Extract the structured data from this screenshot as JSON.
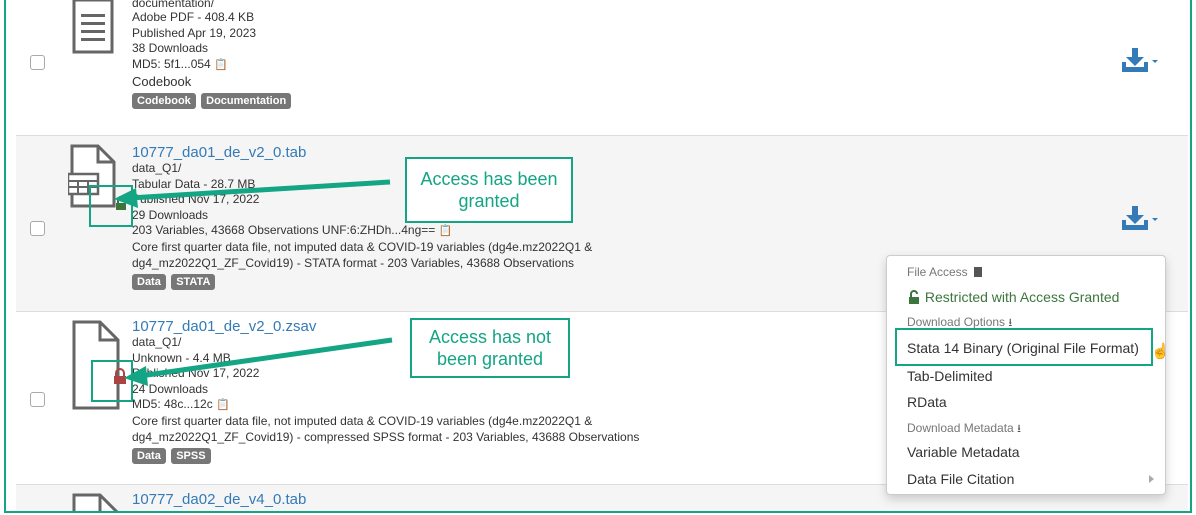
{
  "files": [
    {
      "folder_partial": "documentation/",
      "type_size": "Adobe PDF - 408.4 KB",
      "published": "Published Apr 19, 2023",
      "downloads": "38 Downloads",
      "checksum": "MD5: 5f1...054",
      "description": "Codebook",
      "tags": [
        "Codebook",
        "Documentation"
      ]
    },
    {
      "name": "10777_da01_de_v2_0.tab",
      "folder": "data_Q1/",
      "type_size": "Tabular Data - 28.7 MB",
      "published": "Published Nov 17, 2022",
      "downloads": "29 Downloads",
      "checksum": "203 Variables, 43668 Observations UNF:6:ZHDh...4ng==",
      "description_1": "Core first quarter data file, not imputed data & COVID-19 variables (dg4e.mz2022Q1 &",
      "description_2": "dg4_mz2022Q1_ZF_Covid19) - STATA format - 203 Variables, 43688 Observations",
      "tags": [
        "Data",
        "STATA"
      ]
    },
    {
      "name": "10777_da01_de_v2_0.zsav",
      "folder": "data_Q1/",
      "type_size": "Unknown - 4.4 MB",
      "published": "Published Nov 17, 2022",
      "downloads": "24 Downloads",
      "checksum": "MD5: 48c...12c",
      "description_1": "Core first quarter data file, not imputed data & COVID-19 variables (dg4e.mz2022Q1 &",
      "description_2": "dg4_mz2022Q1_ZF_Covid19) - compressed SPSS format - 203 Variables, 43688 Observations",
      "tags": [
        "Data",
        "SPSS"
      ]
    },
    {
      "name": "10777_da02_de_v4_0.tab"
    }
  ],
  "annotations": {
    "granted_line1": "Access has been",
    "granted_line2": "granted",
    "not_granted_line1": "Access has not",
    "not_granted_line2": "been granted"
  },
  "menu": {
    "file_access_header": "File Access",
    "restricted_label": "Restricted with Access Granted",
    "download_options_header": "Download Options",
    "options": [
      "Stata 14 Binary (Original File Format)",
      "Tab-Delimited",
      "RData"
    ],
    "download_metadata_header": "Download Metadata",
    "metadata_options": [
      "Variable Metadata",
      "Data File Citation"
    ]
  },
  "colors": {
    "accent": "#13a584",
    "link": "#337ab7",
    "download_icon": "#337ab7",
    "unlocked": "#3c763d",
    "locked": "#a94442",
    "tag": "#777777"
  },
  "icons": [
    "document-icon",
    "tabular-file-icon",
    "generic-file-icon",
    "unlock-icon",
    "lock-icon",
    "download-icon",
    "caret-down-icon",
    "checksum-copy-icon",
    "file-icon",
    "download-small-icon",
    "chevron-right-icon",
    "hand-cursor-icon"
  ]
}
